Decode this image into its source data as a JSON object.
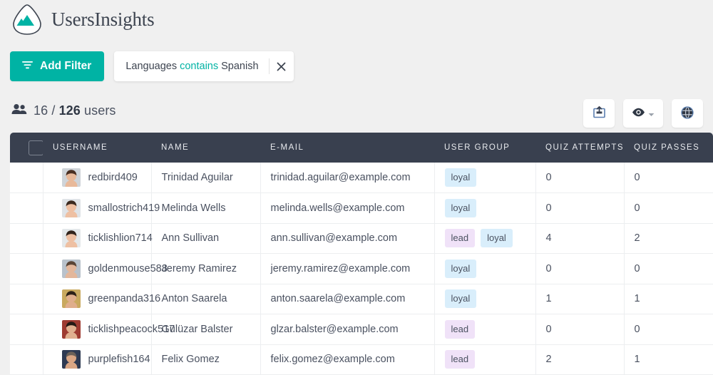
{
  "brand": {
    "name": "UsersInsights",
    "logo_icon": "mountain-triangle-logo",
    "accent_color": "#00b3a4"
  },
  "toolbar": {
    "add_filter_label": "Add Filter",
    "add_filter_icon": "filter-icon",
    "filter_chip": {
      "field": "Languages",
      "operator": "contains",
      "value": "Spanish",
      "close_icon": "close-icon"
    }
  },
  "summary": {
    "people_icon": "people-icon",
    "shown": "16",
    "separator": "/",
    "total": "126",
    "unit": "users"
  },
  "actions": [
    {
      "name": "export-button",
      "icon": "export-icon"
    },
    {
      "name": "columns-visibility-button",
      "icon": "eye-icon",
      "has_dropdown": true,
      "dropdown_icon": "chevron-down-icon"
    },
    {
      "name": "globe-button",
      "icon": "globe-icon"
    }
  ],
  "table": {
    "select_all_checkbox": "select-all-checkbox",
    "columns": [
      "USERNAME",
      "NAME",
      "E-MAIL",
      "USER GROUP",
      "QUIZ ATTEMPTS",
      "QUIZ PASSES"
    ],
    "rows": [
      {
        "username": "redbird409",
        "name": "Trinidad Aguilar",
        "email": "trinidad.aguilar@example.com",
        "groups": [
          "loyal"
        ],
        "quiz_attempts": "0",
        "quiz_passes": "0",
        "avatar": {
          "skin": "#e8b99a",
          "hair": "#4a2f22",
          "bg": "#cfd4d9"
        }
      },
      {
        "username": "smallostrich419",
        "name": "Melinda Wells",
        "email": "melinda.wells@example.com",
        "groups": [
          "loyal"
        ],
        "quiz_attempts": "0",
        "quiz_passes": "0",
        "avatar": {
          "skin": "#eec0a3",
          "hair": "#3b2a20",
          "bg": "#dfe3e7"
        }
      },
      {
        "username": "ticklishlion714",
        "name": "Ann Sullivan",
        "email": "ann.sullivan@example.com",
        "groups": [
          "lead",
          "loyal"
        ],
        "quiz_attempts": "4",
        "quiz_passes": "2",
        "avatar": {
          "skin": "#eec0a3",
          "hair": "#32241c",
          "bg": "#e4e8ea"
        }
      },
      {
        "username": "goldenmouse588",
        "name": "Jeremy Ramirez",
        "email": "jeremy.ramirez@example.com",
        "groups": [
          "loyal"
        ],
        "quiz_attempts": "0",
        "quiz_passes": "0",
        "avatar": {
          "skin": "#e3b79b",
          "hair": "#5a4536",
          "bg": "#b9c2cb"
        }
      },
      {
        "username": "greenpanda316",
        "name": "Anton Saarela",
        "email": "anton.saarela@example.com",
        "groups": [
          "loyal"
        ],
        "quiz_attempts": "1",
        "quiz_passes": "1",
        "avatar": {
          "skin": "#dfae8c",
          "hair": "#2d2117",
          "bg": "#c9a95f"
        }
      },
      {
        "username": "ticklishpeacock517",
        "name": "Gülüzar Balster",
        "email": "glzar.balster@example.com",
        "groups": [
          "lead"
        ],
        "quiz_attempts": "0",
        "quiz_passes": "0",
        "avatar": {
          "skin": "#e0b08f",
          "hair": "#241a14",
          "bg": "#9e3b31"
        }
      },
      {
        "username": "purplefish164",
        "name": "Felix Gomez",
        "email": "felix.gomez@example.com",
        "groups": [
          "lead"
        ],
        "quiz_attempts": "2",
        "quiz_passes": "1",
        "avatar": {
          "skin": "#d9a684",
          "hair": "#6b6158",
          "bg": "#2e3a52"
        }
      }
    ]
  },
  "badge_colors": {
    "loyal": "#d9eefb",
    "lead": "#f0e2f8"
  }
}
